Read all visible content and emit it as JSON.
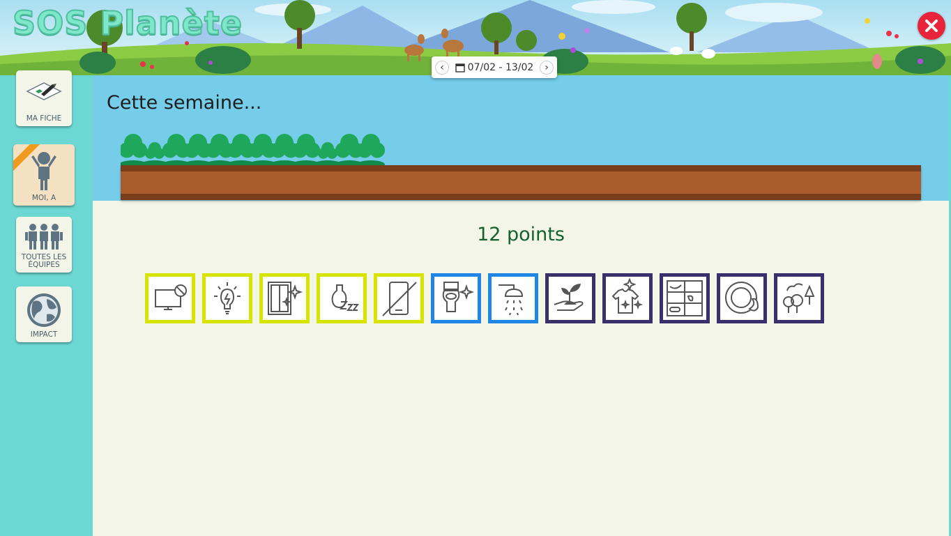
{
  "header": {
    "title": "SOS Planète",
    "date_range": "07/02 - 13/02",
    "prev_label": "‹",
    "next_label": "›",
    "calendar_icon": "calendar-icon",
    "close_icon": "close-icon",
    "close_color": "#e8243a"
  },
  "sidebar": {
    "items": [
      {
        "label": "MA FICHE",
        "icon": "eraser-pencil-icon"
      },
      {
        "label": "MOI, A",
        "icon": "person-icon",
        "active": true
      },
      {
        "label": "TOUTES LES ÉQUIPES",
        "icon": "group-icon"
      },
      {
        "label": "IMPACT",
        "icon": "globe-icon"
      }
    ]
  },
  "main": {
    "heading": "Cette semaine...",
    "points": "12 points",
    "tree_count": 12,
    "actions": [
      {
        "icon": "tv-off-icon",
        "color": "#d6e400"
      },
      {
        "icon": "lightbulb-icon",
        "color": "#d6e400"
      },
      {
        "icon": "clean-window-icon",
        "color": "#d6e400"
      },
      {
        "icon": "sleeping-vase-icon",
        "color": "#d6e400"
      },
      {
        "icon": "no-phone-icon",
        "color": "#d6e400"
      },
      {
        "icon": "clean-toilet-icon",
        "color": "#1f86e5"
      },
      {
        "icon": "shower-icon",
        "color": "#1f86e5"
      },
      {
        "icon": "plant-hand-icon",
        "color": "#392f6b"
      },
      {
        "icon": "clean-shirt-icon",
        "color": "#392f6b"
      },
      {
        "icon": "fridge-food-icon",
        "color": "#392f6b"
      },
      {
        "icon": "plate-icon",
        "color": "#392f6b"
      },
      {
        "icon": "trees-icon",
        "color": "#392f6b"
      }
    ]
  }
}
